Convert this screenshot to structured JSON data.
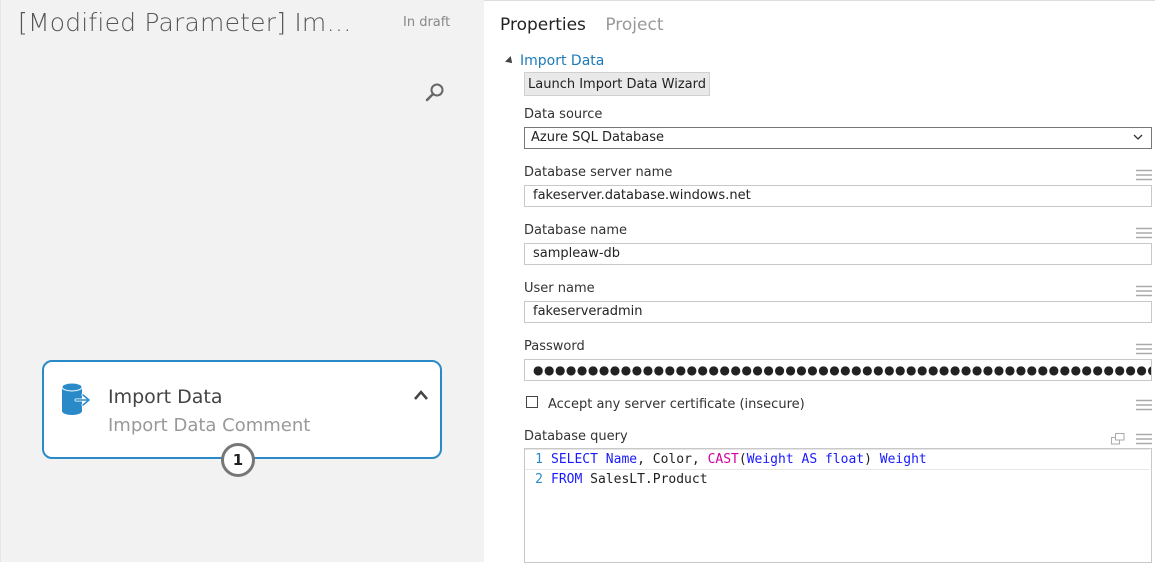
{
  "experiment": {
    "title": "[Modified Parameter] Im…",
    "status": "In draft"
  },
  "module": {
    "name": "Import Data",
    "comment": "Import Data Comment",
    "port_label": "1"
  },
  "properties": {
    "tabs": [
      {
        "label": "Properties",
        "active": true
      },
      {
        "label": "Project",
        "active": false
      }
    ],
    "section_title": "Import Data",
    "wizard_button": "Launch Import Data Wizard",
    "data_source": {
      "label": "Data source",
      "value": "Azure SQL Database"
    },
    "server_name": {
      "label": "Database server name",
      "value": "fakeserver.database.windows.net"
    },
    "database_name": {
      "label": "Database name",
      "value": "sampleaw-db"
    },
    "user_name": {
      "label": "User name",
      "value": "fakeserveradmin"
    },
    "password": {
      "label": "Password",
      "value": "●●●●●●●●●●●●●●●●●●●●●●●●●●●●●●●●●●●●●●●●●●●●●●●●●●●●●●●●●●●●●●●●●●"
    },
    "accept_cert": {
      "label": "Accept any server certificate (insecure)",
      "checked": false
    },
    "query": {
      "label": "Database query",
      "lines": [
        {
          "num": "1",
          "tokens": [
            {
              "t": "SELECT",
              "c": "kw"
            },
            {
              "t": " ",
              "c": "tx"
            },
            {
              "t": "Name",
              "c": "kw"
            },
            {
              "t": ", Color, ",
              "c": "tx"
            },
            {
              "t": "CAST",
              "c": "fn"
            },
            {
              "t": "(",
              "c": "tx"
            },
            {
              "t": "Weight AS float",
              "c": "kw"
            },
            {
              "t": ") ",
              "c": "tx"
            },
            {
              "t": "Weight",
              "c": "kw"
            }
          ]
        },
        {
          "num": "2",
          "tokens": [
            {
              "t": "FROM",
              "c": "kw"
            },
            {
              "t": " SalesLT.Product",
              "c": "tx"
            }
          ]
        }
      ]
    }
  },
  "colors": {
    "accent": "#2a8ac8",
    "keyword": "#1a1aff",
    "function": "#d000a0",
    "canvas_bg": "#f2f2f2"
  },
  "icons": {
    "search": "search-icon",
    "database": "database-import-icon",
    "collapse": "chevron-up-icon",
    "menu": "hamburger-menu-icon",
    "popout": "popout-icon",
    "dropdown": "chevron-down-icon"
  }
}
